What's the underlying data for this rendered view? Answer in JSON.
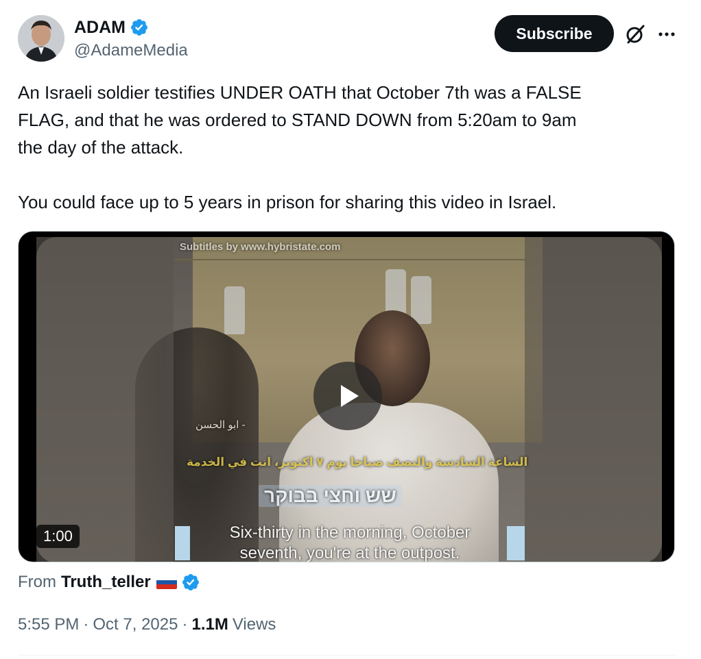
{
  "author": {
    "display_name": "ADAM",
    "handle": "@AdameMedia",
    "verified": true,
    "verified_color": "#1d9bf0"
  },
  "header": {
    "subscribe_label": "Subscribe",
    "grok_icon": "grok-icon",
    "more_icon": "more-dots-icon"
  },
  "tweet": {
    "paragraph_1": "An Israeli soldier testifies UNDER OATH that October 7th was a FALSE\nFLAG, and that he was ordered to STAND DOWN from 5:20am to 9am\nthe day of the attack.",
    "paragraph_2": "You could face up to 5 years in prison for sharing this video in Israel."
  },
  "media": {
    "duration": "1:00",
    "overlay_top": "Subtitles by www.hybristate.com",
    "overlay_name": "ابو الحسن -",
    "overlay_arabic": "الساعة السادسة والنصف صباحا يوم ٧ اكتوبر، انت في الخدمة",
    "overlay_hebrew": "שש וחצי בבוקר",
    "caption_line_1": "Six-thirty in the morning, October",
    "caption_line_2": "seventh, you're at the outpost."
  },
  "source": {
    "from_label": "From",
    "name": "Truth_teller",
    "flag": "russia-flag",
    "verified": true
  },
  "meta": {
    "time": "5:55 PM",
    "date": "Oct 7, 2025",
    "separator": "·",
    "views_count": "1.1M",
    "views_label": "Views"
  }
}
